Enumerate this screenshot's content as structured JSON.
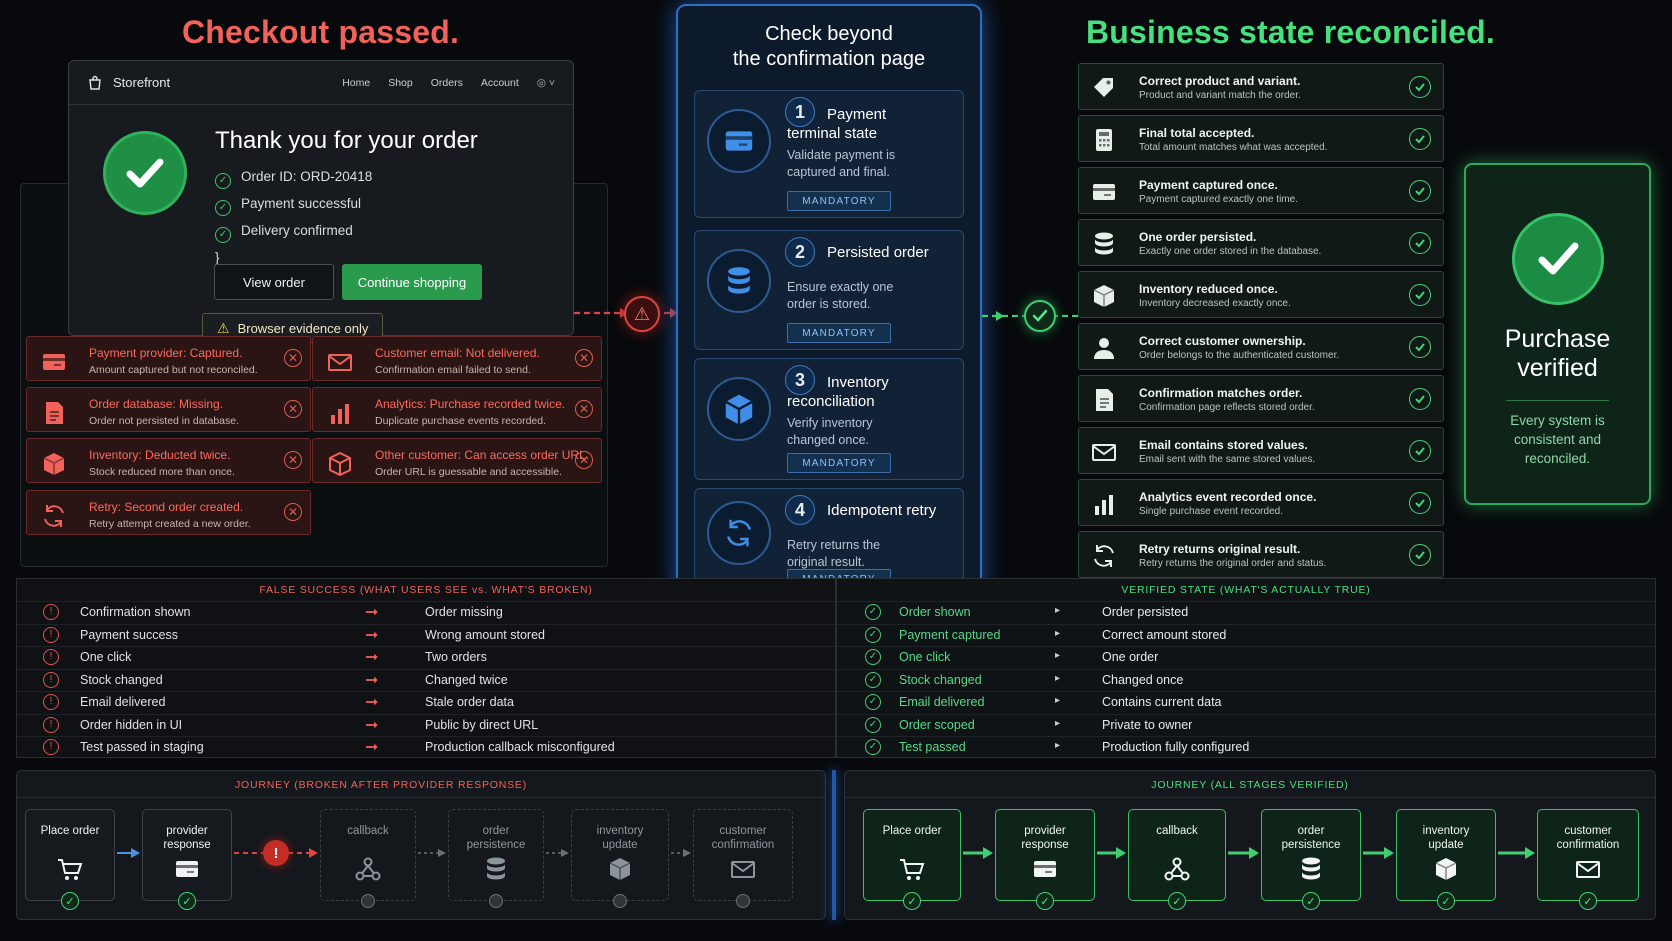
{
  "left": {
    "title": "Checkout passed.",
    "storefront": {
      "brand": "Storefront",
      "nav": [
        "Home",
        "Shop",
        "Orders",
        "Account"
      ],
      "heading": "Thank you for your order",
      "checks": [
        "Order ID: ORD-20418",
        "Payment successful",
        "Delivery confirmed"
      ],
      "view_order": "View order",
      "continue": "Continue shopping"
    },
    "evidence": "Browser evidence only",
    "errors": [
      {
        "title": "Payment provider: Captured.",
        "desc": "Amount captured but not reconciled.",
        "icon": "payment-card-icon"
      },
      {
        "title": "Customer email: Not delivered.",
        "desc": "Confirmation email failed to send.",
        "icon": "envelope-icon"
      },
      {
        "title": "Order database: Missing.",
        "desc": "Order not persisted in database.",
        "icon": "document-icon"
      },
      {
        "title": "Analytics: Purchase recorded twice.",
        "desc": "Duplicate purchase events recorded.",
        "icon": "bar-chart-icon"
      },
      {
        "title": "Inventory: Deducted twice.",
        "desc": "Stock reduced more than once.",
        "icon": "box-icon"
      },
      {
        "title": "Other customer: Can access order URL.",
        "desc": "Order URL is guessable and accessible.",
        "icon": "box-outline-icon"
      },
      {
        "title": "Retry: Second order created.",
        "desc": "Retry attempt created a new order.",
        "icon": "refresh-icon"
      }
    ]
  },
  "middle": {
    "title_line1": "Check beyond",
    "title_line2": "the confirmation page",
    "steps": [
      {
        "num": "1",
        "title1": "Payment",
        "title2": "terminal state",
        "desc1": "Validate payment is",
        "desc2": "captured and final.",
        "badge": "MANDATORY",
        "icon": "payment-card-icon"
      },
      {
        "num": "2",
        "title1": "Persisted order",
        "title2": "",
        "desc1": "Ensure exactly one",
        "desc2": "order is stored.",
        "badge": "MANDATORY",
        "icon": "database-icon"
      },
      {
        "num": "3",
        "title1": "Inventory",
        "title2": "reconciliation",
        "desc1": "Verify inventory",
        "desc2": "changed once.",
        "badge": "MANDATORY",
        "icon": "cube-icon"
      },
      {
        "num": "4",
        "title1": "Idempotent retry",
        "title2": "",
        "desc1": "Retry returns the",
        "desc2": "original result.",
        "badge": "MANDATORY",
        "icon": "refresh-icon"
      }
    ]
  },
  "right": {
    "title": "Business state reconciled.",
    "checks": [
      {
        "title": "Correct product and variant.",
        "desc": "Product and variant match the order.",
        "icon": "tag-icon"
      },
      {
        "title": "Final total accepted.",
        "desc": "Total amount matches what was accepted.",
        "icon": "calculator-icon"
      },
      {
        "title": "Payment captured once.",
        "desc": "Payment captured exactly one time.",
        "icon": "payment-card-icon"
      },
      {
        "title": "One order persisted.",
        "desc": "Exactly one order stored in the database.",
        "icon": "database-icon"
      },
      {
        "title": "Inventory reduced once.",
        "desc": "Inventory decreased exactly once.",
        "icon": "box-icon"
      },
      {
        "title": "Correct customer ownership.",
        "desc": "Order belongs to the authenticated customer.",
        "icon": "user-icon"
      },
      {
        "title": "Confirmation matches order.",
        "desc": "Confirmation page reflects stored order.",
        "icon": "document-icon"
      },
      {
        "title": "Email contains stored values.",
        "desc": "Email sent with the same stored values.",
        "icon": "envelope-icon"
      },
      {
        "title": "Analytics event recorded once.",
        "desc": "Single purchase event recorded.",
        "icon": "bar-chart-icon"
      },
      {
        "title": "Retry returns original result.",
        "desc": "Retry returns the original order and status.",
        "icon": "refresh-icon"
      }
    ],
    "verified_title1": "Purchase",
    "verified_title2": "verified",
    "verified_desc1": "Every system is",
    "verified_desc2": "consistent and",
    "verified_desc3": "reconciled."
  },
  "false_table": {
    "header": "FALSE SUCCESS (WHAT USERS SEE vs. WHAT'S BROKEN)",
    "rows": [
      [
        "Confirmation shown",
        "Order missing"
      ],
      [
        "Payment success",
        "Wrong amount stored"
      ],
      [
        "One click",
        "Two orders"
      ],
      [
        "Stock changed",
        "Changed twice"
      ],
      [
        "Email delivered",
        "Stale order data"
      ],
      [
        "Order hidden in UI",
        "Public by direct URL"
      ],
      [
        "Test passed in staging",
        "Production callback misconfigured"
      ]
    ]
  },
  "true_table": {
    "header": "VERIFIED STATE (WHAT'S ACTUALLY TRUE)",
    "rows": [
      [
        "Order shown",
        "Order persisted"
      ],
      [
        "Payment captured",
        "Correct amount stored"
      ],
      [
        "One click",
        "One order"
      ],
      [
        "Stock changed",
        "Changed once"
      ],
      [
        "Email delivered",
        "Contains current data"
      ],
      [
        "Order scoped",
        "Private to owner"
      ],
      [
        "Test passed",
        "Production fully configured"
      ]
    ]
  },
  "journey_broken": {
    "header": "JOURNEY (BROKEN AFTER PROVIDER RESPONSE)",
    "stages": [
      [
        "Place order",
        ""
      ],
      [
        "provider",
        "response"
      ],
      [
        "callback",
        ""
      ],
      [
        "order",
        "persistence"
      ],
      [
        "inventory",
        "update"
      ],
      [
        "customer",
        "confirmation"
      ]
    ]
  },
  "journey_ok": {
    "header": "JOURNEY (ALL STAGES VERIFIED)",
    "stages": [
      [
        "Place order",
        ""
      ],
      [
        "provider",
        "response"
      ],
      [
        "callback",
        ""
      ],
      [
        "order",
        "persistence"
      ],
      [
        "inventory",
        "update"
      ],
      [
        "customer",
        "confirmation"
      ]
    ]
  },
  "colors": {
    "red": "#f0625a",
    "green": "#48e07e",
    "blue": "#2f6fbf"
  }
}
